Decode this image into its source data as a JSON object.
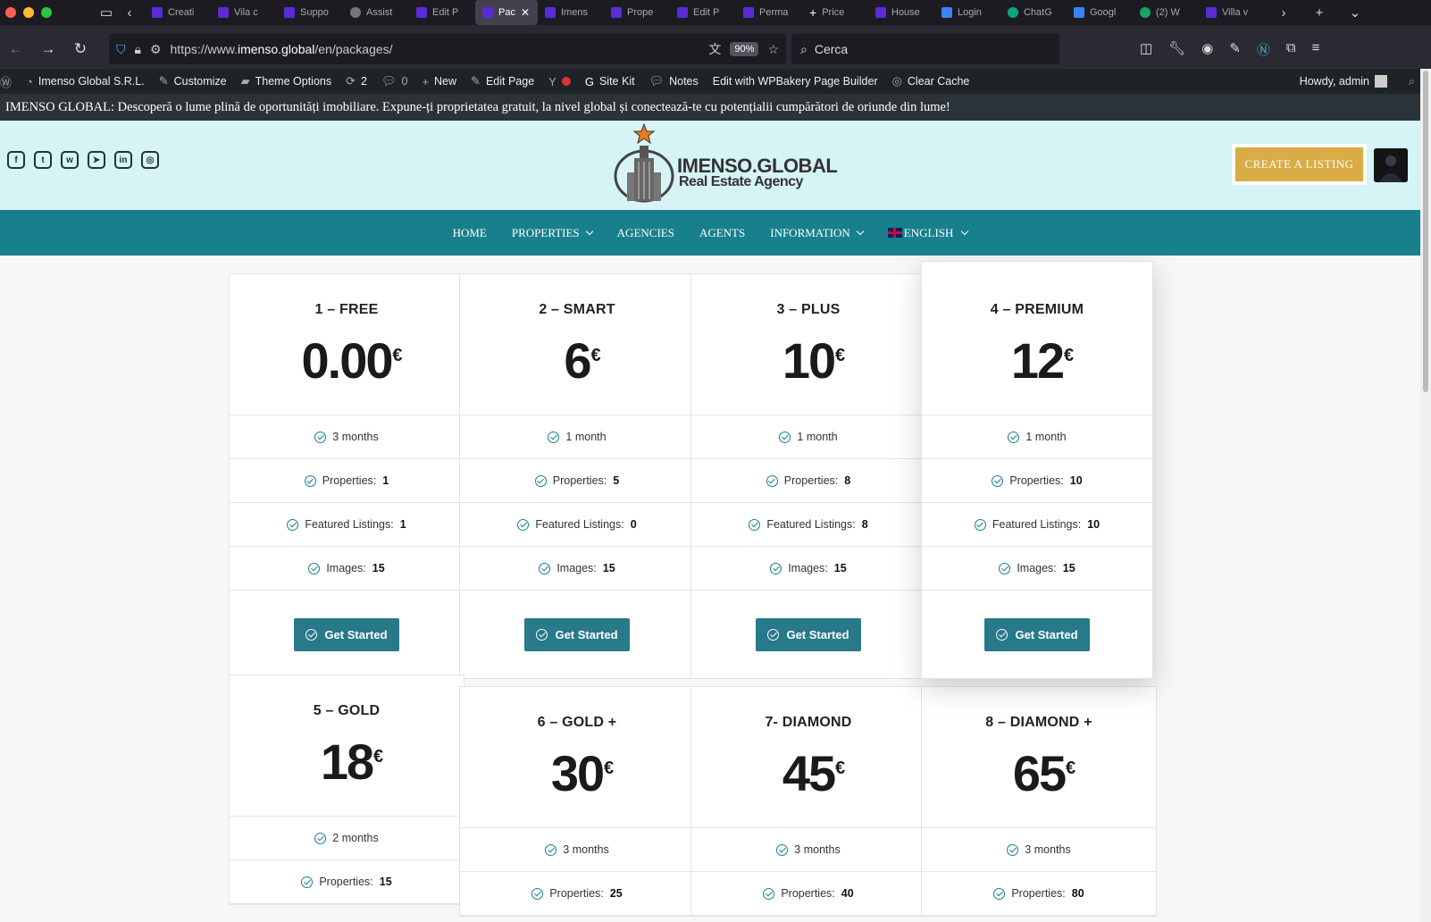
{
  "browser": {
    "tabs": [
      {
        "label": "Creati",
        "icon": "imenso-favicon-icon"
      },
      {
        "label": "Vila c",
        "icon": "imenso-favicon-icon"
      },
      {
        "label": "Suppo",
        "icon": "imenso-favicon-icon"
      },
      {
        "label": "Assist",
        "icon": "assistant-favicon-icon"
      },
      {
        "label": "Edit P",
        "icon": "imenso-favicon-icon"
      },
      {
        "label": "Pac",
        "icon": "imenso-favicon-icon",
        "active": true
      },
      {
        "label": "Imens",
        "icon": "imenso-favicon-icon"
      },
      {
        "label": "Prope",
        "icon": "imenso-favicon-icon"
      },
      {
        "label": "Edit P",
        "icon": "imenso-favicon-icon"
      },
      {
        "label": "Perma",
        "icon": "imenso-favicon-icon"
      },
      {
        "label": "Price",
        "icon": "plus-icon"
      },
      {
        "label": "House",
        "icon": "imenso-favicon-icon"
      },
      {
        "label": "Login",
        "icon": "login-favicon-icon"
      },
      {
        "label": "ChatG",
        "icon": "chatgpt-favicon-icon"
      },
      {
        "label": "Googl",
        "icon": "google-translate-icon"
      },
      {
        "label": "(2) W",
        "icon": "whatsapp-favicon-icon"
      },
      {
        "label": "Villa v",
        "icon": "imenso-favicon-icon"
      }
    ],
    "url_prefix": "https://www.",
    "url_domain": "imenso.global",
    "url_path": "/en/packages/",
    "zoom": "90%",
    "search_placeholder": "Cerca"
  },
  "wp_admin_bar": {
    "site_name": "Imenso Global S.R.L.",
    "customize": "Customize",
    "theme_options": "Theme Options",
    "updates_count": "2",
    "comments_count": "0",
    "new": "New",
    "edit_page": "Edit Page",
    "site_kit": "Site Kit",
    "notes": "Notes",
    "wpbakery": "Edit with WPBakery Page Builder",
    "clear_cache": "Clear Cache",
    "howdy": "Howdy, admin"
  },
  "announcement": "IMENSO GLOBAL: Descoperă o lume plină de oportunități imobiliare. Expune-ți proprietatea gratuit, la nivel global și conectează-te cu potențialii cumpărători de oriunde din lume!",
  "header": {
    "brand_line1": "IMENSO.GLOBAL",
    "brand_line2": "Real Estate Agency",
    "cta": "CREATE A LISTING"
  },
  "nav": {
    "home": "HOME",
    "properties": "PROPERTIES",
    "agencies": "AGENCIES",
    "agents": "AGENTS",
    "information": "INFORMATION",
    "language": "ENGLISH"
  },
  "labels": {
    "properties": "Properties:",
    "featured": "Featured Listings:",
    "images": "Images:",
    "get_started": "Get Started",
    "currency": "€"
  },
  "packages": [
    {
      "name": "1 – FREE",
      "price": "0.00",
      "duration": "3 months",
      "properties": "1",
      "featured": "1",
      "images": "15"
    },
    {
      "name": "2 – SMART",
      "price": "6",
      "duration": "1 month",
      "properties": "5",
      "featured": "0",
      "images": "15"
    },
    {
      "name": "3 – PLUS",
      "price": "10",
      "duration": "1 month",
      "properties": "8",
      "featured": "8",
      "images": "15"
    },
    {
      "name": "4 – PREMIUM",
      "price": "12",
      "duration": "1 month",
      "properties": "10",
      "featured": "10",
      "images": "15"
    },
    {
      "name": "5 – GOLD",
      "price": "18",
      "duration": "2 months",
      "properties": "15"
    },
    {
      "name": "6 – GOLD +",
      "price": "30",
      "duration": "3 months",
      "properties": "25"
    },
    {
      "name": "7- DIAMOND",
      "price": "45",
      "duration": "3 months",
      "properties": "40"
    },
    {
      "name": "8 – DIAMOND +",
      "price": "65",
      "duration": "3 months",
      "properties": "80"
    }
  ],
  "colors": {
    "nav_teal": "#187f8c",
    "button_teal": "#28798a",
    "cta_gold": "#d9ac46",
    "header_bg": "#d6f3f5"
  }
}
